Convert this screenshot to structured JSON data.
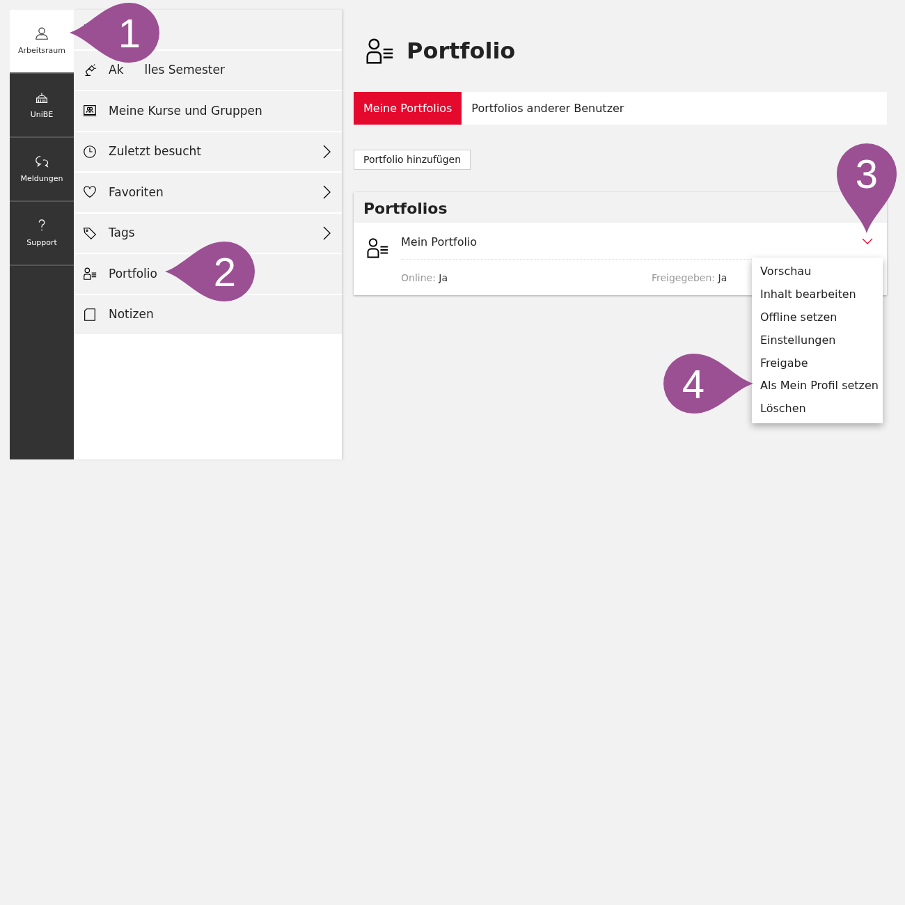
{
  "rail": [
    {
      "label": "Arbeitsraum",
      "selected": true
    },
    {
      "label": "UniBE",
      "selected": false
    },
    {
      "label": "Meldungen",
      "selected": false
    },
    {
      "label": "Support",
      "selected": false
    }
  ],
  "menu": [
    {
      "has_submenu": false
    },
    {
      "label_parts": [
        "Ak",
        "lles Semester"
      ],
      "has_submenu": false
    },
    {
      "label": "Meine Kurse und Gruppen",
      "has_submenu": false
    },
    {
      "label": "Zuletzt besucht",
      "has_submenu": true
    },
    {
      "label": "Favoriten",
      "has_submenu": true
    },
    {
      "label": "Tags",
      "has_submenu": true
    },
    {
      "label": "Portfolio",
      "has_submenu": false
    },
    {
      "label": "Notizen",
      "has_submenu": false
    }
  ],
  "page": {
    "title": "Portfolio",
    "tabs": [
      {
        "label": "Meine Portfolios",
        "selected": true
      },
      {
        "label": "Portfolios anderer Benutzer",
        "selected": false
      }
    ],
    "add_button": "Portfolio hinzufügen",
    "panel": {
      "title": "Portfolios",
      "item": {
        "name": "Mein Portfolio",
        "fields": [
          {
            "label": "Online:",
            "value": "Ja"
          },
          {
            "label": "Freigegeben:",
            "value": "Ja"
          }
        ]
      }
    },
    "dropdown": [
      "Vorschau",
      "Inhalt bearbeiten",
      "Offline setzen",
      "Einstellungen",
      "Freigabe",
      "Als Mein Profil setzen",
      "Löschen"
    ]
  },
  "callouts": [
    {
      "number": "1"
    },
    {
      "number": "2"
    },
    {
      "number": "3"
    },
    {
      "number": "4"
    }
  ]
}
